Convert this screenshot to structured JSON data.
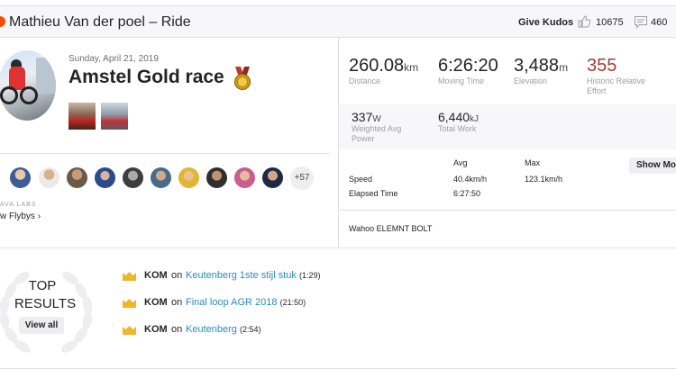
{
  "header": {
    "title": "Mathieu Van der poel – Ride",
    "give_kudos": "Give Kudos",
    "kudos_count": "10675",
    "comment_count": "460"
  },
  "activity": {
    "date": "Sunday, April 21, 2019",
    "name": "Amstel Gold race"
  },
  "flybys": {
    "more_count": "+57",
    "labs_label": "AVA LABS",
    "link": "w Flybys",
    "chevron": "›"
  },
  "stats": {
    "distance": {
      "value": "260.08",
      "unit": "km",
      "label": "Distance"
    },
    "moving_time": {
      "value": "6:26:20",
      "unit": "",
      "label": "Moving Time"
    },
    "elevation": {
      "value": "3,488",
      "unit": "m",
      "label": "Elevation"
    },
    "relative_effort": {
      "value": "355",
      "label_line1": "Historic Relative",
      "label_line2": "Effort"
    },
    "weighted_power": {
      "value": "337",
      "unit": "W",
      "label_line1": "Weighted Avg",
      "label_line2": "Power"
    },
    "total_work": {
      "value": "6,440",
      "unit": "kJ",
      "label": "Total Work"
    }
  },
  "table": {
    "col_avg": "Avg",
    "col_max": "Max",
    "speed_label": "Speed",
    "speed_avg": "40.4km/h",
    "speed_max": "123.1km/h",
    "elapsed_label": "Elapsed Time",
    "elapsed_avg": "6:27:50",
    "show_more": "Show More"
  },
  "device": "Wahoo ELEMNT BOLT",
  "top_results": {
    "title_line1": "TOP",
    "title_line2": "RESULTS",
    "view_all": "View all",
    "items": [
      {
        "badge": "KOM",
        "on": "on",
        "segment": "Keutenberg 1ste stijl stuk",
        "time": "(1:29)"
      },
      {
        "badge": "KOM",
        "on": "on",
        "segment": "Final loop AGR 2018",
        "time": "(21:50)"
      },
      {
        "badge": "KOM",
        "on": "on",
        "segment": "Keutenberg",
        "time": "(2:54)"
      }
    ]
  },
  "colors": {
    "brand": "#fc4c02",
    "link": "#2a8bc0",
    "effort": "#a53c33",
    "crown": "#f1b52c"
  }
}
